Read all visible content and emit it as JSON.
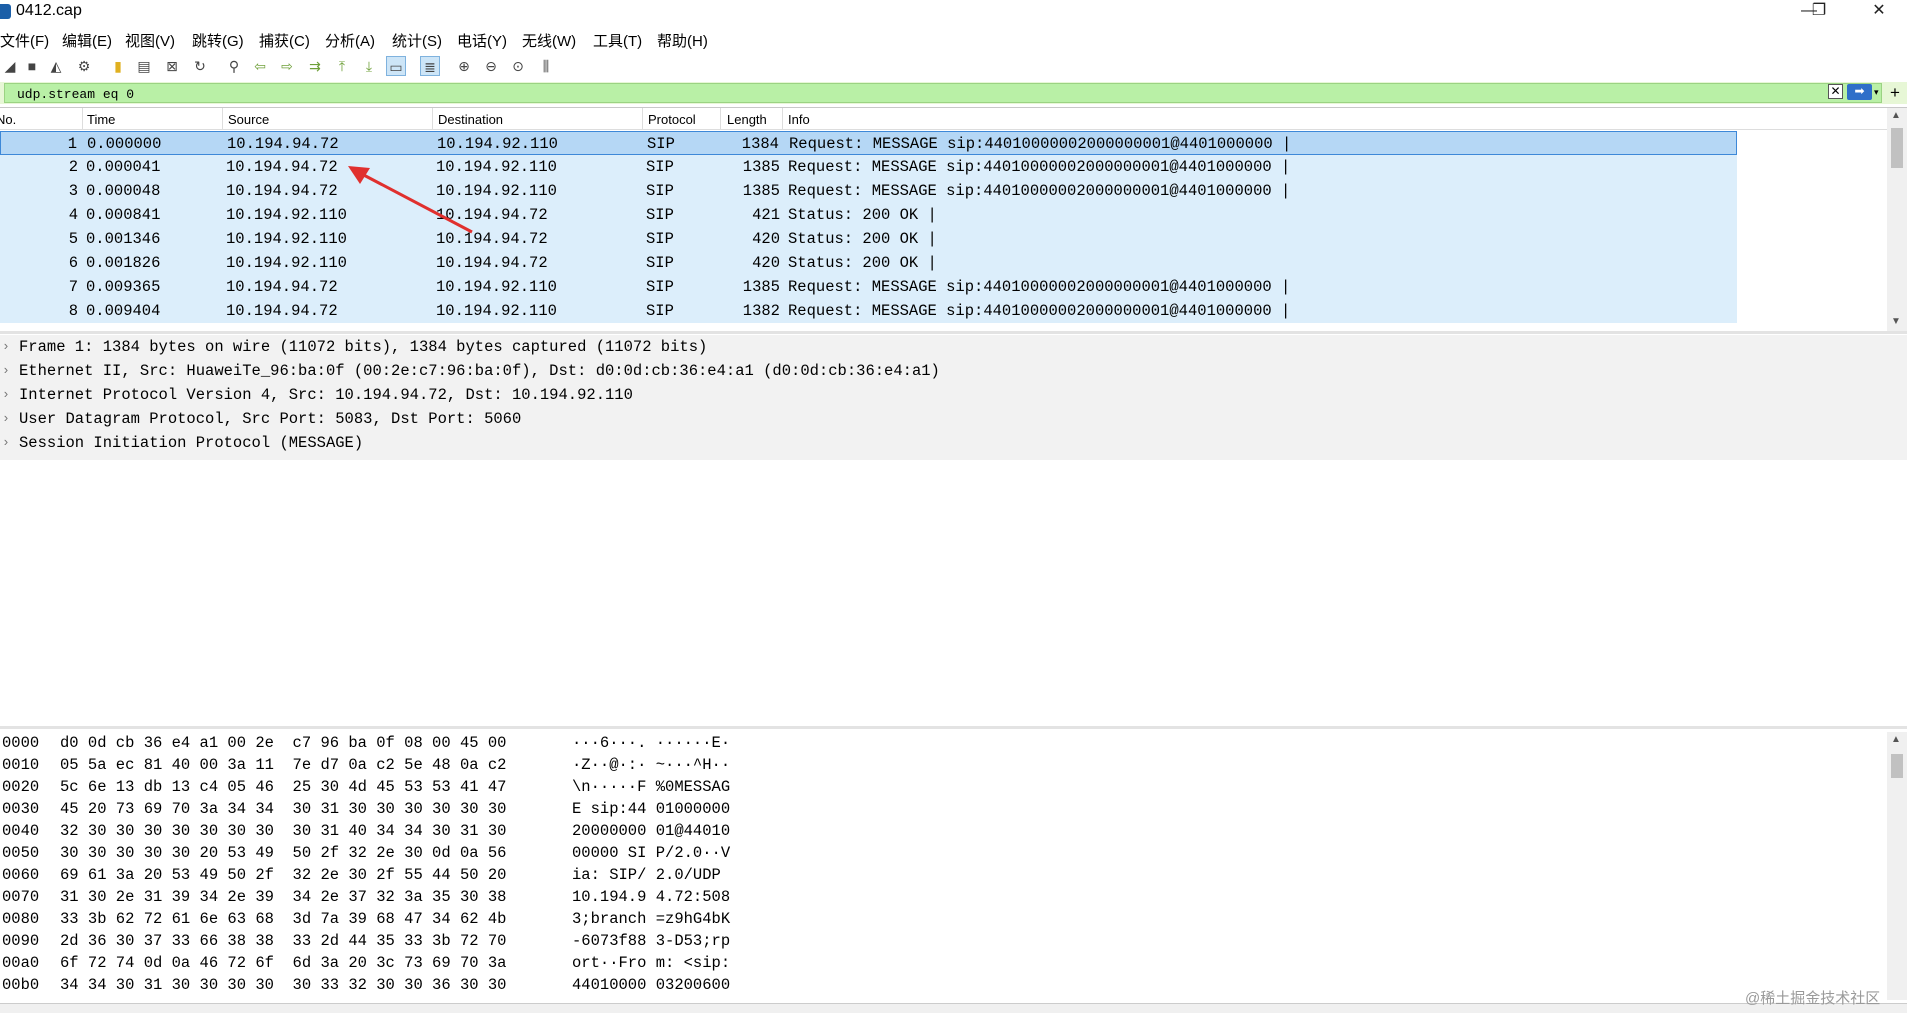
{
  "window": {
    "title": "0412.cap",
    "minimize": "—",
    "restore": "❐",
    "close": "✕"
  },
  "menu": [
    "文件(F)",
    "编辑(E)",
    "视图(V)",
    "跳转(G)",
    "捕获(C)",
    "分析(A)",
    "统计(S)",
    "电话(Y)",
    "无线(W)",
    "工具(T)",
    "帮助(H)"
  ],
  "toolbar_icons": [
    "shark-fin-start-icon",
    "stop-icon",
    "restart-icon",
    "options-icon",
    "open-file-icon",
    "save-file-icon",
    "close-file-icon",
    "reload-icon",
    "find-icon",
    "back-icon",
    "forward-icon",
    "goto-packet-icon",
    "first-packet-icon",
    "last-packet-icon",
    "autoscroll-icon",
    "colorize-icon",
    "zoom-in-icon",
    "zoom-out-icon",
    "zoom-normal-icon",
    "resize-columns-icon"
  ],
  "filter": {
    "value": "udp.stream eq 0",
    "clear": "✕",
    "apply": "➡",
    "dropdown": "▾",
    "add": "+"
  },
  "columns": [
    "No.",
    "Time",
    "Source",
    "Destination",
    "Protocol",
    "Length",
    "Info"
  ],
  "packets": [
    {
      "no": "1",
      "time": "0.000000",
      "src": "10.194.94.72",
      "dst": "10.194.92.110",
      "proto": "SIP",
      "len": "1384",
      "info": "Request: MESSAGE sip:44010000002000000001@4401000000 |"
    },
    {
      "no": "2",
      "time": "0.000041",
      "src": "10.194.94.72",
      "dst": "10.194.92.110",
      "proto": "SIP",
      "len": "1385",
      "info": "Request: MESSAGE sip:44010000002000000001@4401000000 |"
    },
    {
      "no": "3",
      "time": "0.000048",
      "src": "10.194.94.72",
      "dst": "10.194.92.110",
      "proto": "SIP",
      "len": "1385",
      "info": "Request: MESSAGE sip:44010000002000000001@4401000000 |"
    },
    {
      "no": "4",
      "time": "0.000841",
      "src": "10.194.92.110",
      "dst": "10.194.94.72",
      "proto": "SIP",
      "len": "421",
      "info": "Status: 200 OK |"
    },
    {
      "no": "5",
      "time": "0.001346",
      "src": "10.194.92.110",
      "dst": "10.194.94.72",
      "proto": "SIP",
      "len": "420",
      "info": "Status: 200 OK |"
    },
    {
      "no": "6",
      "time": "0.001826",
      "src": "10.194.92.110",
      "dst": "10.194.94.72",
      "proto": "SIP",
      "len": "420",
      "info": "Status: 200 OK |"
    },
    {
      "no": "7",
      "time": "0.009365",
      "src": "10.194.94.72",
      "dst": "10.194.92.110",
      "proto": "SIP",
      "len": "1385",
      "info": "Request: MESSAGE sip:44010000002000000001@4401000000 |"
    },
    {
      "no": "8",
      "time": "0.009404",
      "src": "10.194.94.72",
      "dst": "10.194.92.110",
      "proto": "SIP",
      "len": "1382",
      "info": "Request: MESSAGE sip:44010000002000000001@4401000000 |"
    }
  ],
  "details": [
    "Frame 1: 1384 bytes on wire (11072 bits), 1384 bytes captured (11072 bits)",
    "Ethernet II, Src: HuaweiTe_96:ba:0f (00:2e:c7:96:ba:0f), Dst: d0:0d:cb:36:e4:a1 (d0:0d:cb:36:e4:a1)",
    "Internet Protocol Version 4, Src: 10.194.94.72, Dst: 10.194.92.110",
    "User Datagram Protocol, Src Port: 5083, Dst Port: 5060",
    "Session Initiation Protocol (MESSAGE)"
  ],
  "hexdump": [
    {
      "off": "0000",
      "hex": "d0 0d cb 36 e4 a1 00 2e  c7 96 ba 0f 08 00 45 00",
      "ascii": "···6···. ······E·"
    },
    {
      "off": "0010",
      "hex": "05 5a ec 81 40 00 3a 11  7e d7 0a c2 5e 48 0a c2",
      "ascii": "·Z··@·:· ~···^H··"
    },
    {
      "off": "0020",
      "hex": "5c 6e 13 db 13 c4 05 46  25 30 4d 45 53 53 41 47",
      "ascii": "\\n·····F %0MESSAG"
    },
    {
      "off": "0030",
      "hex": "45 20 73 69 70 3a 34 34  30 31 30 30 30 30 30 30",
      "ascii": "E sip:44 01000000"
    },
    {
      "off": "0040",
      "hex": "32 30 30 30 30 30 30 30  30 31 40 34 34 30 31 30",
      "ascii": "20000000 01@44010"
    },
    {
      "off": "0050",
      "hex": "30 30 30 30 30 20 53 49  50 2f 32 2e 30 0d 0a 56",
      "ascii": "00000 SI P/2.0··V"
    },
    {
      "off": "0060",
      "hex": "69 61 3a 20 53 49 50 2f  32 2e 30 2f 55 44 50 20",
      "ascii": "ia: SIP/ 2.0/UDP "
    },
    {
      "off": "0070",
      "hex": "31 30 2e 31 39 34 2e 39  34 2e 37 32 3a 35 30 38",
      "ascii": "10.194.9 4.72:508"
    },
    {
      "off": "0080",
      "hex": "33 3b 62 72 61 6e 63 68  3d 7a 39 68 47 34 62 4b",
      "ascii": "3;branch =z9hG4bK"
    },
    {
      "off": "0090",
      "hex": "2d 36 30 37 33 66 38 38  33 2d 44 35 33 3b 72 70",
      "ascii": "-6073f88 3-D53;rp"
    },
    {
      "off": "00a0",
      "hex": "6f 72 74 0d 0a 46 72 6f  6d 3a 20 3c 73 69 70 3a",
      "ascii": "ort··Fro m: <sip:"
    },
    {
      "off": "00b0",
      "hex": "34 34 30 31 30 30 30 30  30 33 32 30 30 36 30 30",
      "ascii": "44010000 03200600"
    }
  ],
  "watermark": "@稀土掘金技术社区",
  "colors": {
    "selected_row": "#b5d7f5",
    "row_bg": "#dceefb",
    "filter_bg": "#b9f0a6",
    "arrow": "#e0302e"
  }
}
